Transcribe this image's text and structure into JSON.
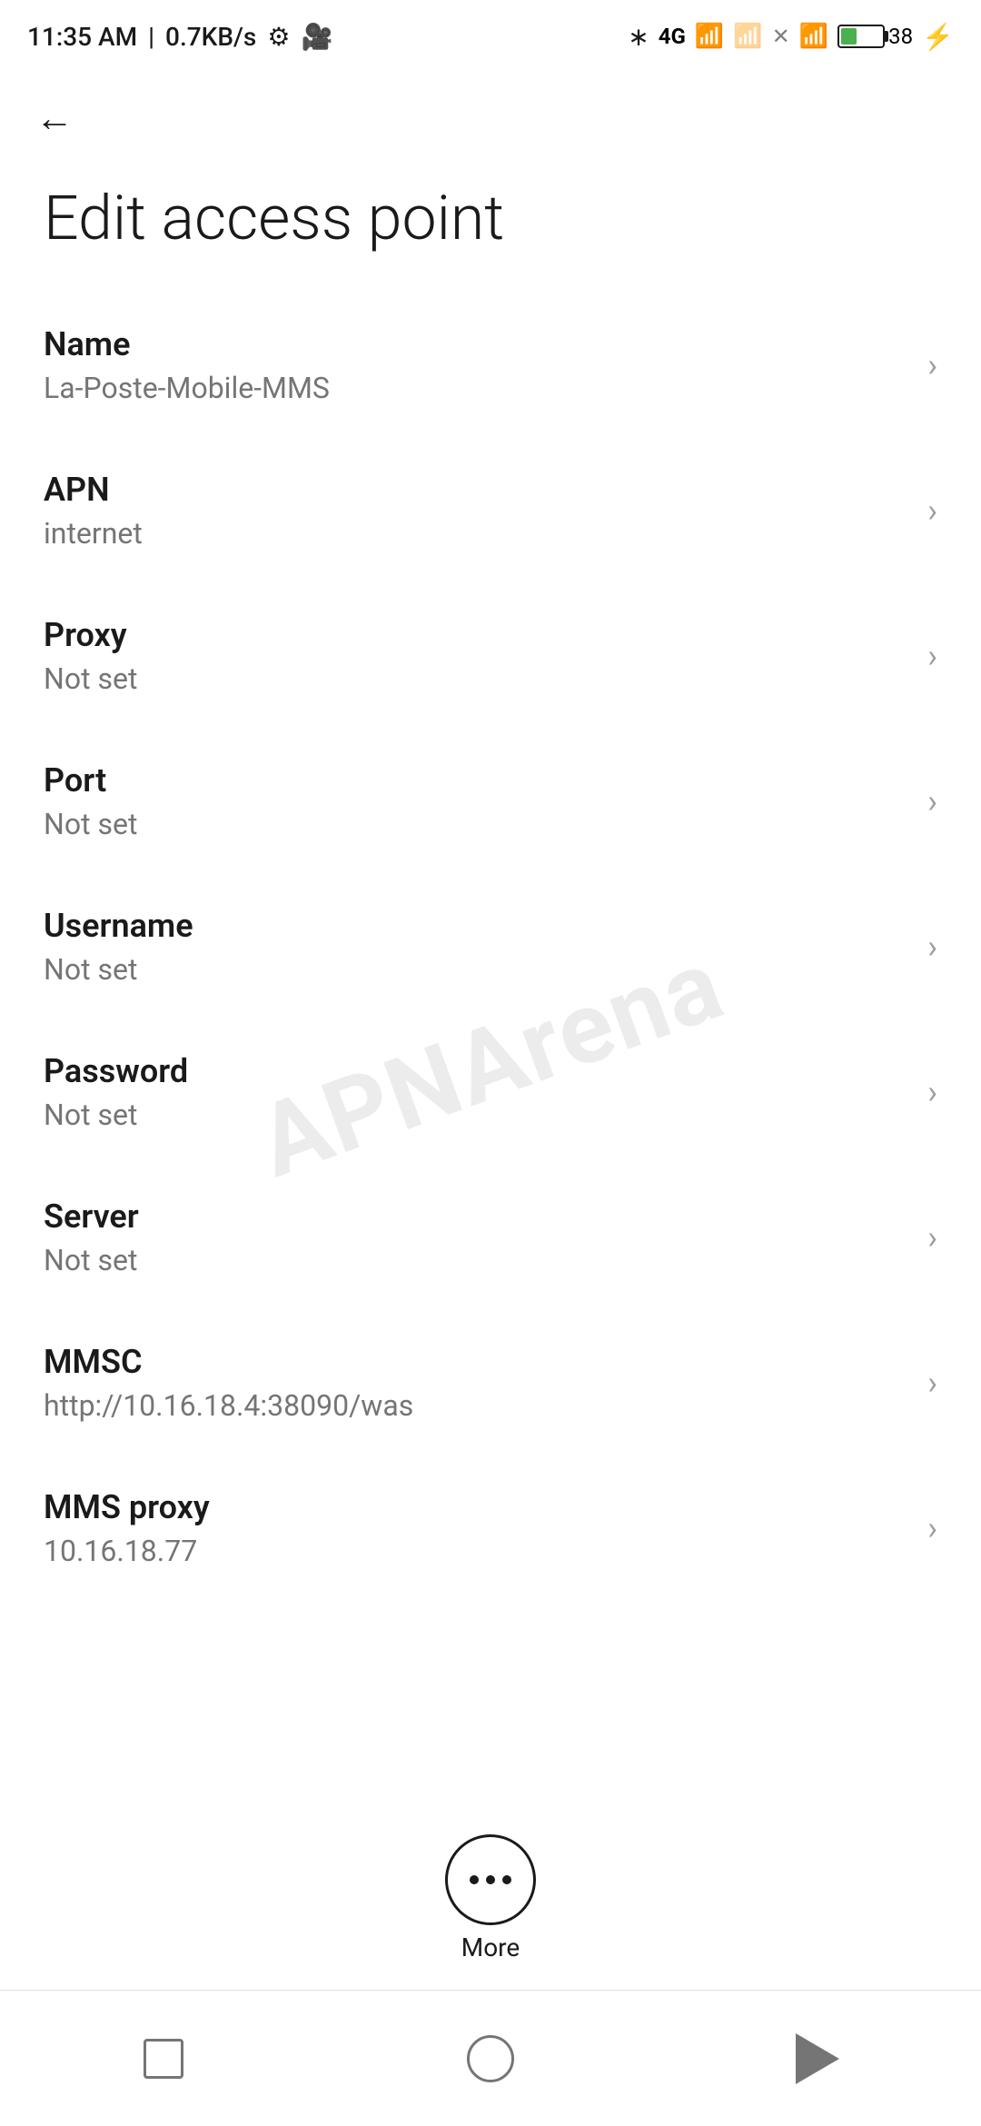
{
  "statusBar": {
    "time": "11:35 AM",
    "networkSpeed": "0.7KB/s",
    "icons": {
      "settings": "⚙",
      "camera": "📹",
      "bluetooth": "bluetooth",
      "network4g": "4G",
      "signal1": "signal",
      "signal2": "signal",
      "wifi": "wifi",
      "battery": "38",
      "bolt": "⚡"
    }
  },
  "nav": {
    "backLabel": "←"
  },
  "page": {
    "title": "Edit access point"
  },
  "settingsItems": [
    {
      "id": "name",
      "title": "Name",
      "value": "La-Poste-Mobile-MMS"
    },
    {
      "id": "apn",
      "title": "APN",
      "value": "internet"
    },
    {
      "id": "proxy",
      "title": "Proxy",
      "value": "Not set"
    },
    {
      "id": "port",
      "title": "Port",
      "value": "Not set"
    },
    {
      "id": "username",
      "title": "Username",
      "value": "Not set"
    },
    {
      "id": "password",
      "title": "Password",
      "value": "Not set"
    },
    {
      "id": "server",
      "title": "Server",
      "value": "Not set"
    },
    {
      "id": "mmsc",
      "title": "MMSC",
      "value": "http://10.16.18.4:38090/was"
    },
    {
      "id": "mms-proxy",
      "title": "MMS proxy",
      "value": "10.16.18.77"
    }
  ],
  "more": {
    "label": "More"
  },
  "bottomNav": {
    "square": "square",
    "circle": "circle",
    "triangle": "triangle"
  },
  "watermark": {
    "text": "APNArena"
  }
}
